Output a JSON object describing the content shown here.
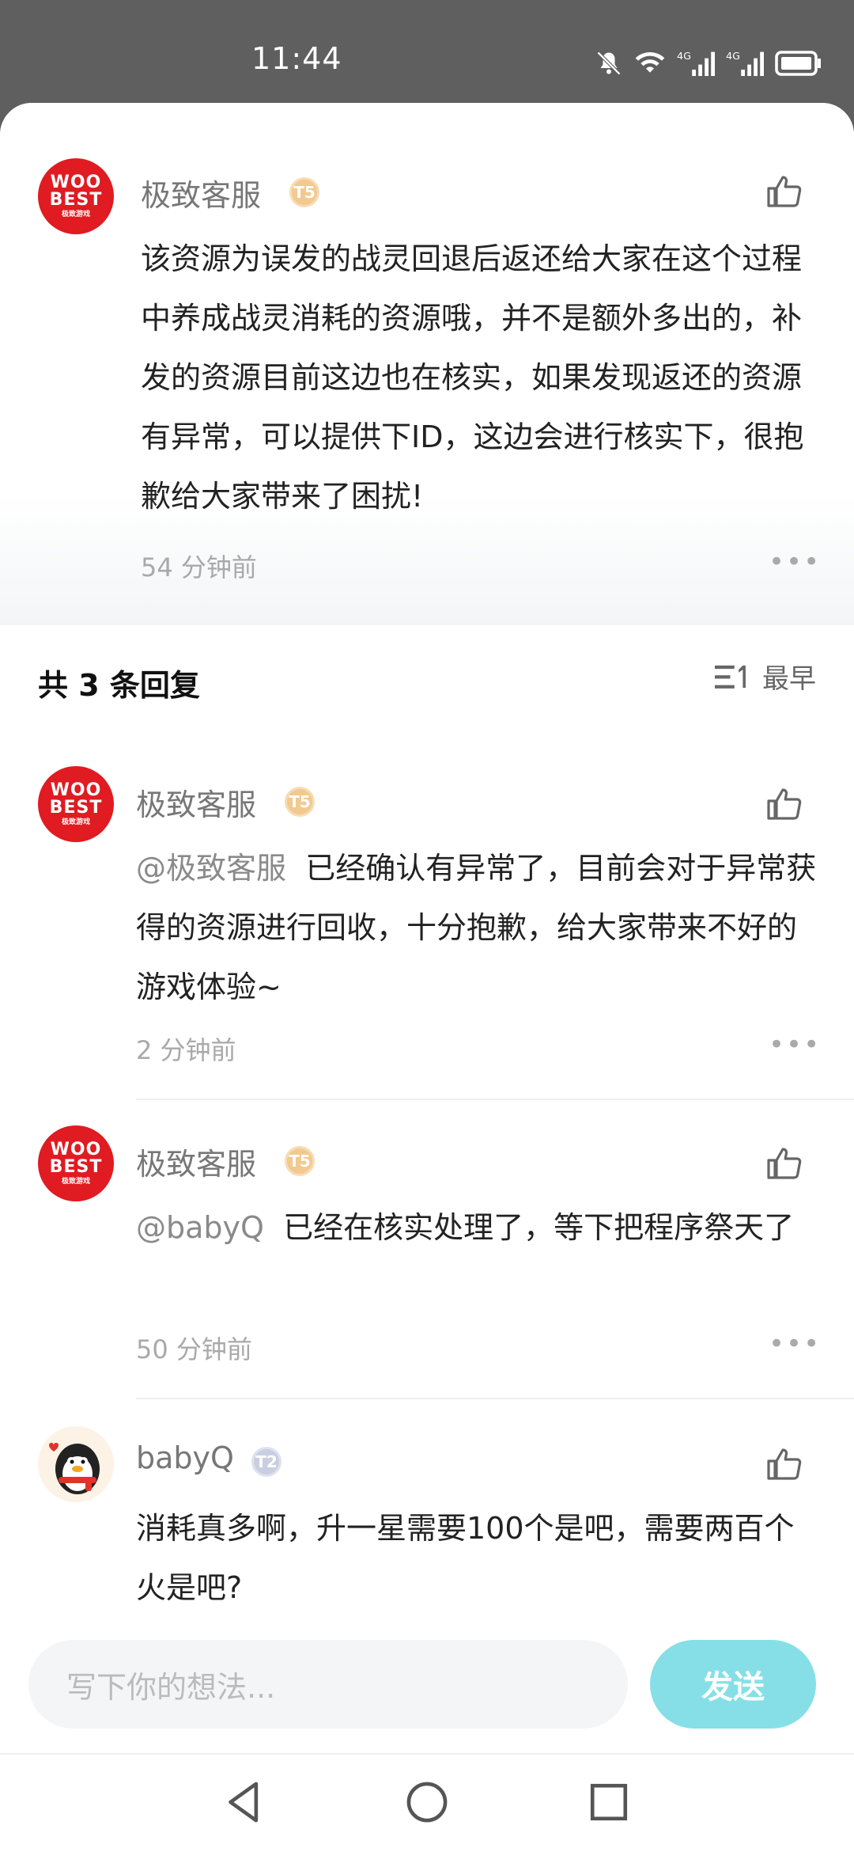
{
  "status_bar": {
    "time": "11:44"
  },
  "main_comment": {
    "username": "极致客服",
    "badge": "T5",
    "text": "该资源为误发的战灵回退后返还给大家在这个过程中养成战灵消耗的资源哦，并不是额外多出的，补发的资源目前这边也在核实，如果发现返还的资源有异常，可以提供下ID，这边会进行核实下，很抱歉给大家带来了困扰!",
    "time": "54 分钟前"
  },
  "replies_header": {
    "title": "共 3 条回复",
    "sort_label": "最早"
  },
  "replies": [
    {
      "username": "极致客服",
      "badge": "T5",
      "mention": "@极致客服",
      "text": "已经确认有异常了，目前会对于异常获得的资源进行回收，十分抱歉，给大家带来不好的游戏体验~",
      "time": "2 分钟前"
    },
    {
      "username": "极致客服",
      "badge": "T5",
      "mention": "@babyQ",
      "text": "已经在核实处理了，等下把程序祭天了",
      "time": "50 分钟前"
    },
    {
      "username": "babyQ",
      "badge": "T2",
      "text": "消耗真多啊，升一星需要100个是吧，需要两百个火是吧?"
    }
  ],
  "composer": {
    "placeholder": "写下你的想法...",
    "send_label": "发送"
  },
  "avatar_logo": {
    "line1": "WOO",
    "line2": "BEST",
    "line3": "极致游戏"
  },
  "colors": {
    "brand_red": "#e01b22",
    "send_button": "#86dfe6"
  }
}
